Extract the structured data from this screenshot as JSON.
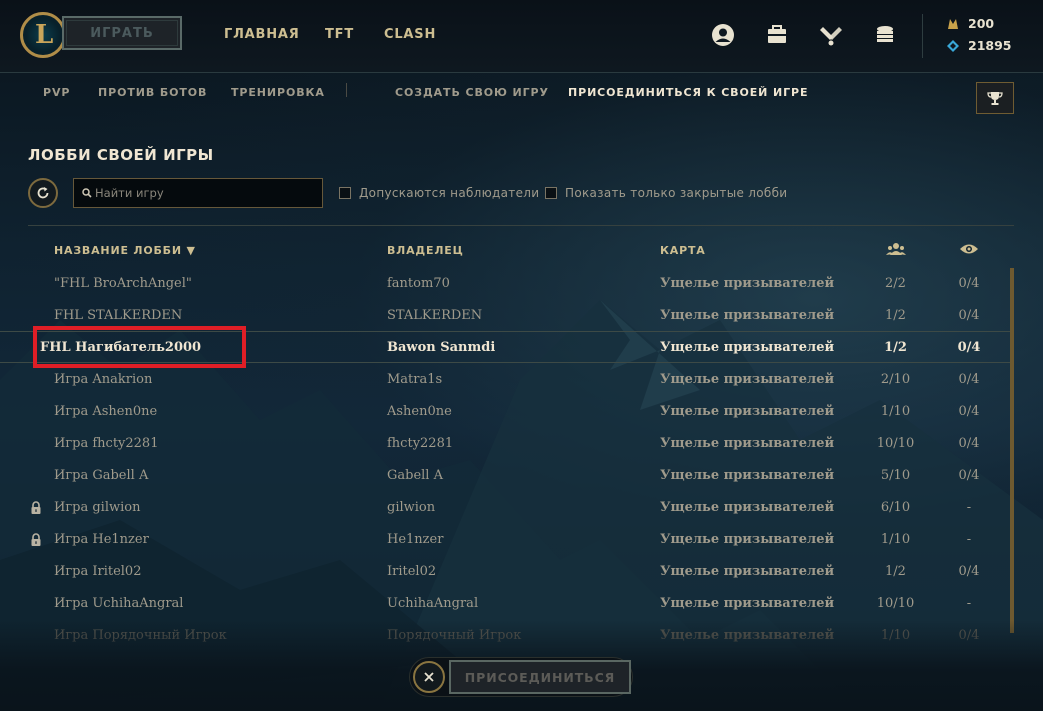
{
  "topbar": {
    "play_label": "ИГРАТЬ",
    "nav": [
      "ГЛАВНАЯ",
      "TFT",
      "CLASH"
    ],
    "icons": [
      "profile-icon",
      "collection-icon",
      "loot-icon",
      "store-icon"
    ],
    "currency": {
      "rp": "200",
      "be": "21895"
    }
  },
  "subnav": {
    "items": [
      "PVP",
      "ПРОТИВ БОТОВ",
      "ТРЕНИРОВКА",
      "СОЗДАТЬ СВОЮ ИГРУ",
      "ПРИСОЕДИНИТЬСЯ К СВОЕЙ ИГРЕ"
    ],
    "active": "ПРИСОЕДИНИТЬСЯ К СВОЕЙ ИГРЕ"
  },
  "page": {
    "title": "ЛОББИ СВОЕЙ ИГРЫ",
    "search_placeholder": "Найти игру",
    "filter_spectators": "Допускаются наблюдатели",
    "filter_private": "Показать только закрытые лобби"
  },
  "table": {
    "headers": {
      "name": "НАЗВАНИЕ ЛОББИ ▼",
      "owner": "ВЛАДЕЛЕЦ",
      "map": "КАРТА"
    },
    "rows": [
      {
        "name": "\"FHL BroArchAngel\"",
        "owner": "fantom70",
        "map": "Ущелье призывателей",
        "players": "2/2",
        "spectators": "0/4",
        "locked": false
      },
      {
        "name": "FHL STALKERDEN",
        "owner": "STALKERDEN",
        "map": "Ущелье призывателей",
        "players": "1/2",
        "spectators": "0/4",
        "locked": false
      },
      {
        "name": "FHL Нагибатель2000",
        "owner": "Bawon Sanmdi",
        "map": "Ущелье призывателей",
        "players": "1/2",
        "spectators": "0/4",
        "locked": false,
        "selected": true
      },
      {
        "name": "Игра Anakrion",
        "owner": "Matra1s",
        "map": "Ущелье призывателей",
        "players": "2/10",
        "spectators": "0/4",
        "locked": false
      },
      {
        "name": "Игра Ashen0ne",
        "owner": "Ashen0ne",
        "map": "Ущелье призывателей",
        "players": "1/10",
        "spectators": "0/4",
        "locked": false
      },
      {
        "name": "Игра fhcty2281",
        "owner": "fhcty2281",
        "map": "Ущелье призывателей",
        "players": "10/10",
        "spectators": "0/4",
        "locked": false
      },
      {
        "name": "Игра Gabell A",
        "owner": "Gabell A",
        "map": "Ущелье призывателей",
        "players": "5/10",
        "spectators": "0/4",
        "locked": false
      },
      {
        "name": "Игра gilwion",
        "owner": "gilwion",
        "map": "Ущелье призывателей",
        "players": "6/10",
        "spectators": "-",
        "locked": true
      },
      {
        "name": "Игра He1nzer",
        "owner": "He1nzer",
        "map": "Ущелье призывателей",
        "players": "1/10",
        "spectators": "-",
        "locked": true
      },
      {
        "name": "Игра Iritel02",
        "owner": "Iritel02",
        "map": "Ущелье призывателей",
        "players": "1/2",
        "spectators": "0/4",
        "locked": false
      },
      {
        "name": "Игра UchihaAngral",
        "owner": "UchihaAngral",
        "map": "Ущелье призывателей",
        "players": "10/10",
        "spectators": "-",
        "locked": false
      },
      {
        "name": "Игра Порядочный Игрок",
        "owner": "Порядочный Игрок",
        "map": "Ущелье призывателей",
        "players": "1/10",
        "spectators": "0/4",
        "locked": false,
        "faded": true
      }
    ]
  },
  "footer": {
    "join_label": "ПРИСОЕДИНИТЬСЯ"
  },
  "colors": {
    "gold": "#cdbe91",
    "highlight": "#e01e26",
    "text": "#a09b8c",
    "selected_text": "#f0e6d2"
  }
}
